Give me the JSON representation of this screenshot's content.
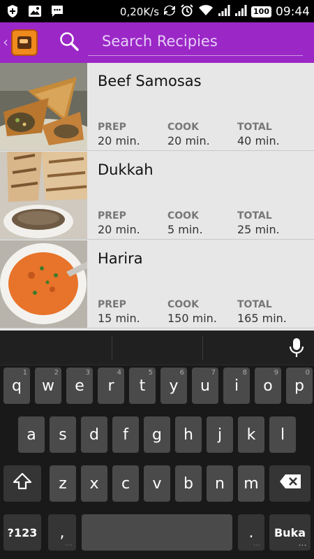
{
  "status_bar": {
    "net_speed": "0,20K/s",
    "battery": "100",
    "time": "09:44"
  },
  "action_bar": {
    "search_placeholder": "Search Recipies",
    "icons": [
      "back-chevron-icon",
      "app-logo-icon",
      "search-icon"
    ]
  },
  "recipes": [
    {
      "title": "Beef Samosas",
      "prep_label": "PREP",
      "prep": "20 min.",
      "cook_label": "COOK",
      "cook": "20 min.",
      "total_label": "TOTAL",
      "total": "40 min."
    },
    {
      "title": "Dukkah",
      "prep_label": "PREP",
      "prep": "20 min.",
      "cook_label": "COOK",
      "cook": "5 min.",
      "total_label": "TOTAL",
      "total": "25 min."
    },
    {
      "title": "Harira",
      "prep_label": "PREP",
      "prep": "15 min.",
      "cook_label": "COOK",
      "cook": "150 min.",
      "total_label": "TOTAL",
      "total": "165 min."
    }
  ],
  "keyboard": {
    "row1": [
      {
        "k": "q",
        "h": "1"
      },
      {
        "k": "w",
        "h": "2"
      },
      {
        "k": "e",
        "h": "3"
      },
      {
        "k": "r",
        "h": "4"
      },
      {
        "k": "t",
        "h": "5"
      },
      {
        "k": "y",
        "h": "6"
      },
      {
        "k": "u",
        "h": "7"
      },
      {
        "k": "i",
        "h": "8"
      },
      {
        "k": "o",
        "h": "9"
      },
      {
        "k": "p",
        "h": "0"
      }
    ],
    "row2": [
      "a",
      "s",
      "d",
      "f",
      "g",
      "h",
      "j",
      "k",
      "l"
    ],
    "row3": [
      "z",
      "x",
      "c",
      "v",
      "b",
      "n",
      "m"
    ],
    "symbols_label": "?123",
    "comma": ",",
    "period": ".",
    "action_label": "Buka"
  },
  "colors": {
    "accent": "#9b27c7",
    "list_bg": "#e7e7e7",
    "keyboard_bg": "#191919"
  }
}
